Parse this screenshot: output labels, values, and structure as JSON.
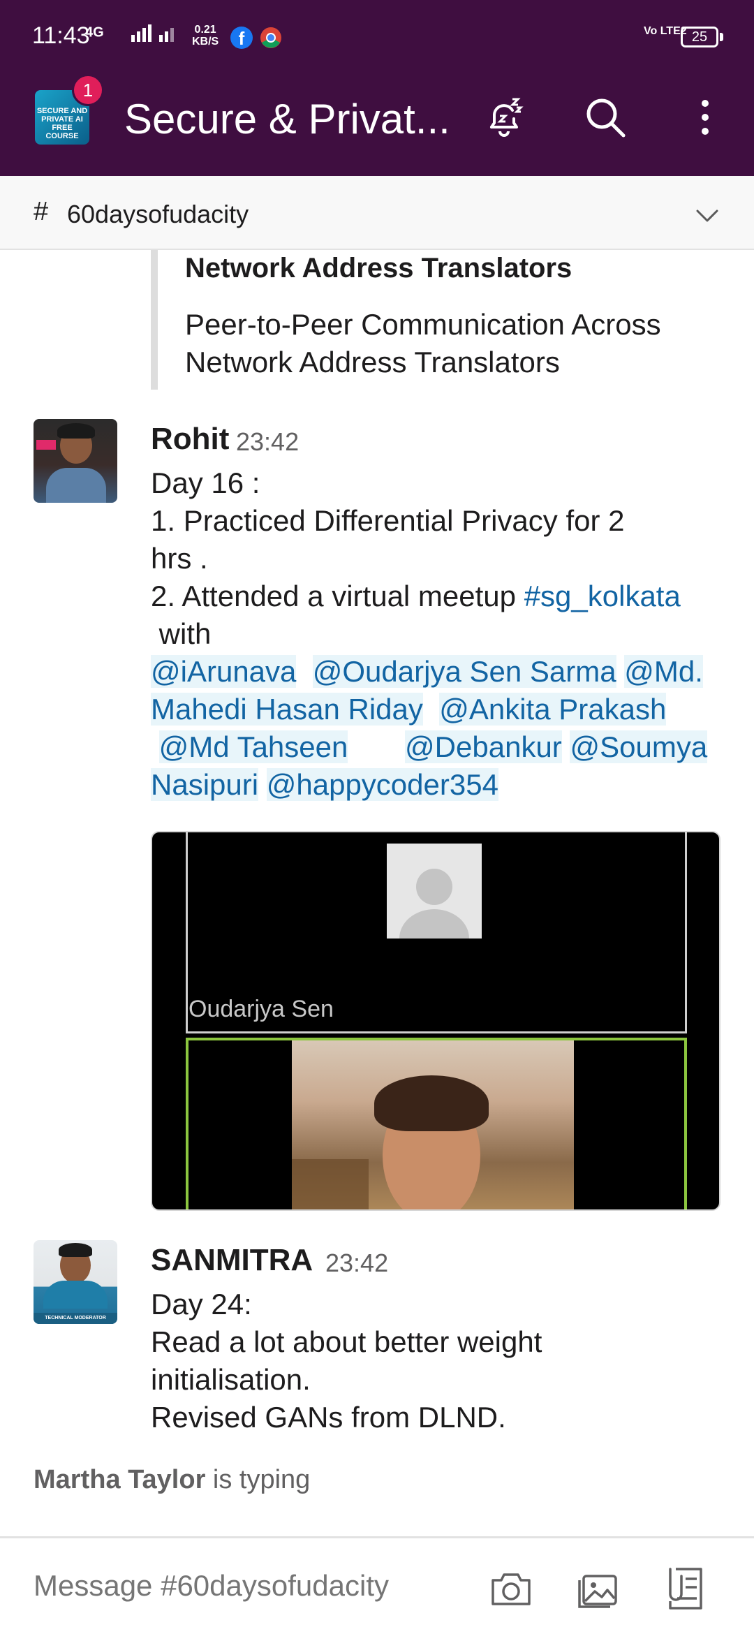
{
  "status_bar": {
    "time": "11:43",
    "network": "4G",
    "speed_value": "0.21",
    "speed_unit": "KB/S",
    "volte": "Vo LTE2",
    "battery": "25"
  },
  "header": {
    "workspace_title": "Secure & Privat...",
    "notification_count": "1",
    "workspace_icon_text": "SECURE AND PRIVATE AI FREE COURSE"
  },
  "channel": {
    "hash": "#",
    "name": "60daysofudacity"
  },
  "unfurl": {
    "title": "Network Address Translators",
    "description": "Peer-to-Peer Communication Across Network Address Translators"
  },
  "messages": [
    {
      "author": "Rohit",
      "time": "23:42",
      "lines": {
        "l1": "Day 16 :",
        "l2": "1. Practiced Differential Privacy for 2",
        "l3": "hrs .",
        "l4": "2. Attended a virtual meetup ",
        "l4_channel": "#sg_kolkata",
        "l5": " with"
      },
      "mentions": {
        "m1": "@iArunava",
        "m2": "@Oudarjya Sen Sarma",
        "m3": "@Md.",
        "m4": "Mahedi Hasan Riday",
        "m5": "@Ankita Prakash",
        "m6": "@Md Tahseen",
        "m7": "@Debankur",
        "m8": "@Soumya",
        "m9": "Nasipuri",
        "m10": "@happycoder354"
      },
      "attachment": {
        "participant_name": "Oudarjya Sen"
      }
    },
    {
      "author": "SANMITRA",
      "time": "23:42",
      "lines": {
        "l1": "Day 24:",
        "l2": "Read a lot about better weight",
        "l3": "initialisation.",
        "l4": "Revised GANs from DLND."
      }
    }
  ],
  "typing": {
    "name": "Martha Taylor",
    "suffix": " is typing"
  },
  "composer": {
    "placeholder": "Message #60daysofudacity"
  },
  "colors": {
    "brand": "#3f0e40",
    "link": "#1264a3",
    "badge": "#e01e5a"
  }
}
